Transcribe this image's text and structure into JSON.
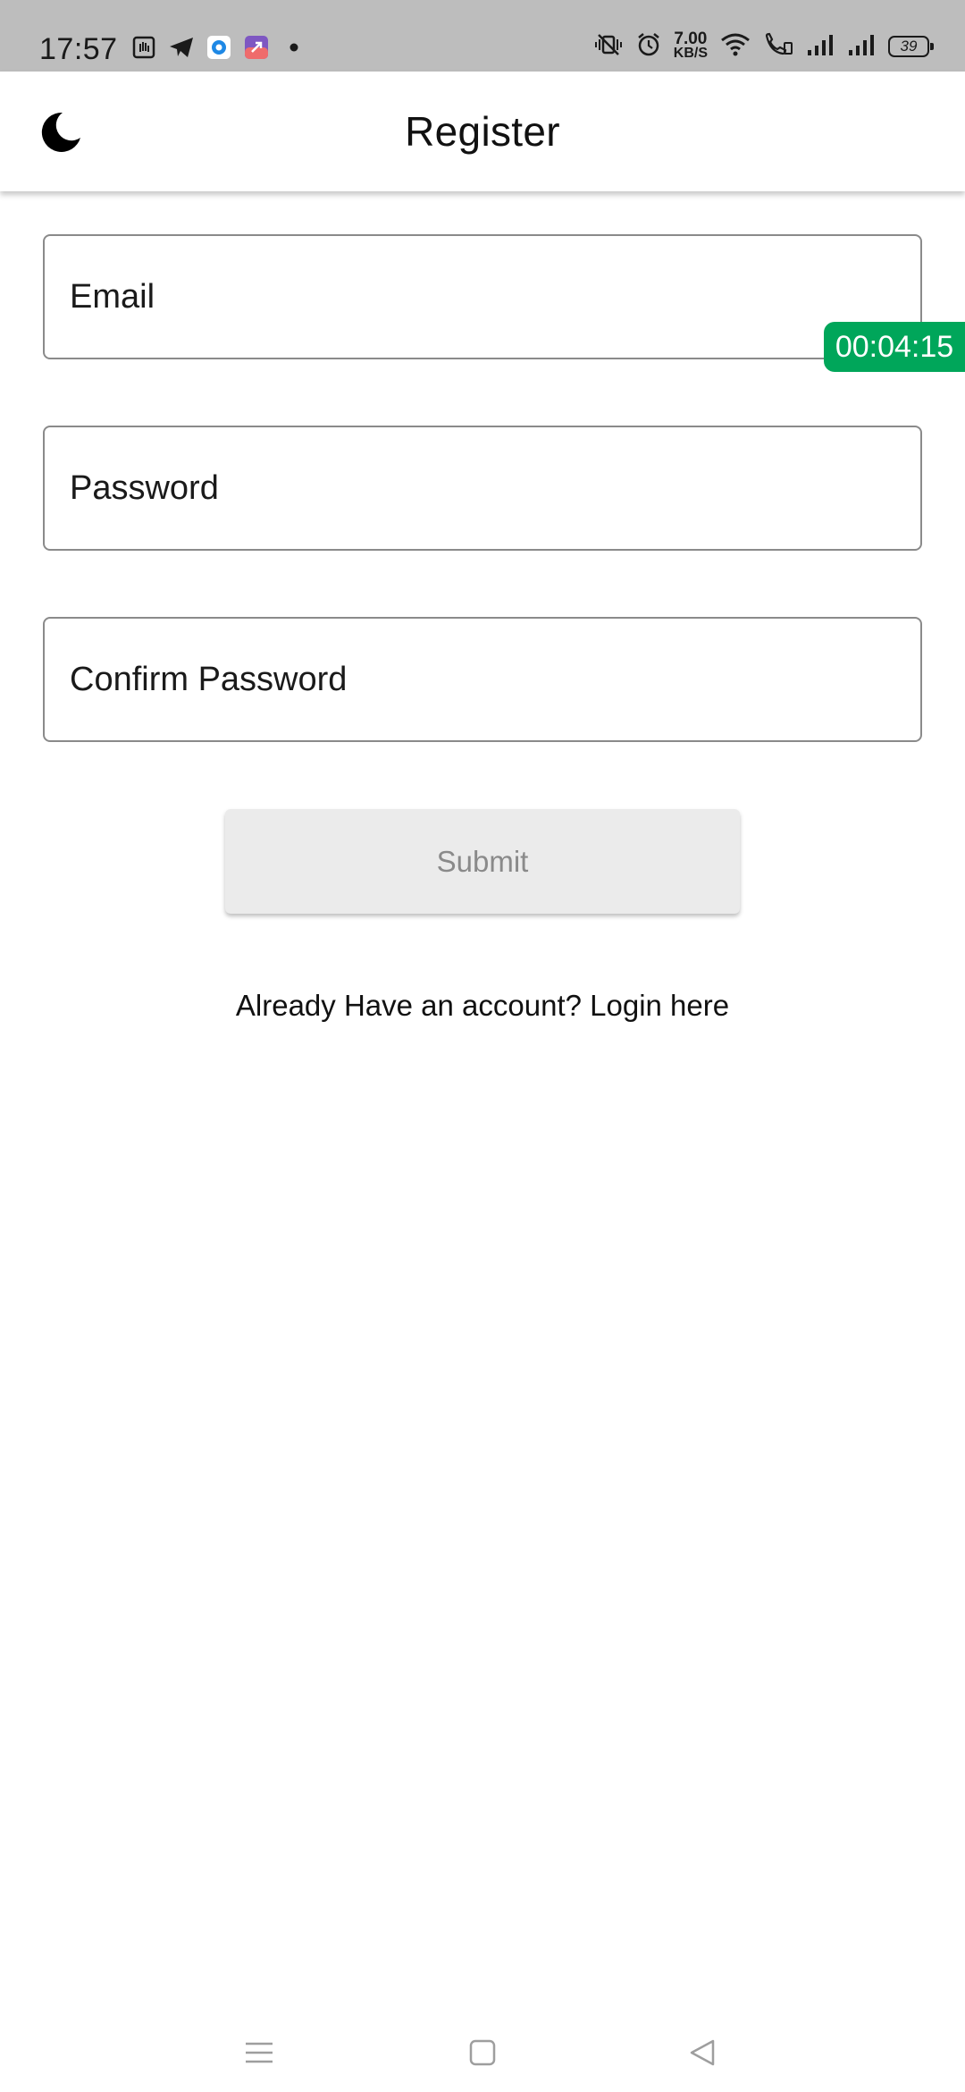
{
  "status_bar": {
    "time": "17:57",
    "net_speed_value": "7.00",
    "net_speed_unit": "KB/S",
    "battery": "39",
    "notification_icons": [
      "hand-app-icon",
      "telegram-icon",
      "circle-app-icon",
      "shortcut-app-icon",
      "more-dot-icon"
    ],
    "system_icons": [
      "vibrate-icon",
      "alarm-icon",
      "wifi-icon",
      "volte-call-icon",
      "signal-icon",
      "signal-icon"
    ]
  },
  "app_bar": {
    "title": "Register",
    "theme_icon": "moon-icon"
  },
  "form": {
    "email_placeholder": "Email",
    "password_placeholder": "Password",
    "confirm_placeholder": "Confirm Password",
    "submit_label": "Submit",
    "login_link": "Already Have an account? Login here"
  },
  "overlay": {
    "timer": "00:04:15"
  },
  "colors": {
    "status_bar": "#bdbdbd",
    "timer_badge": "#00a65a",
    "submit_bg": "#ebebeb",
    "submit_text": "#8a8a8a"
  },
  "nav_bar": {
    "icons": [
      "menu-icon",
      "home-icon",
      "back-icon"
    ]
  }
}
